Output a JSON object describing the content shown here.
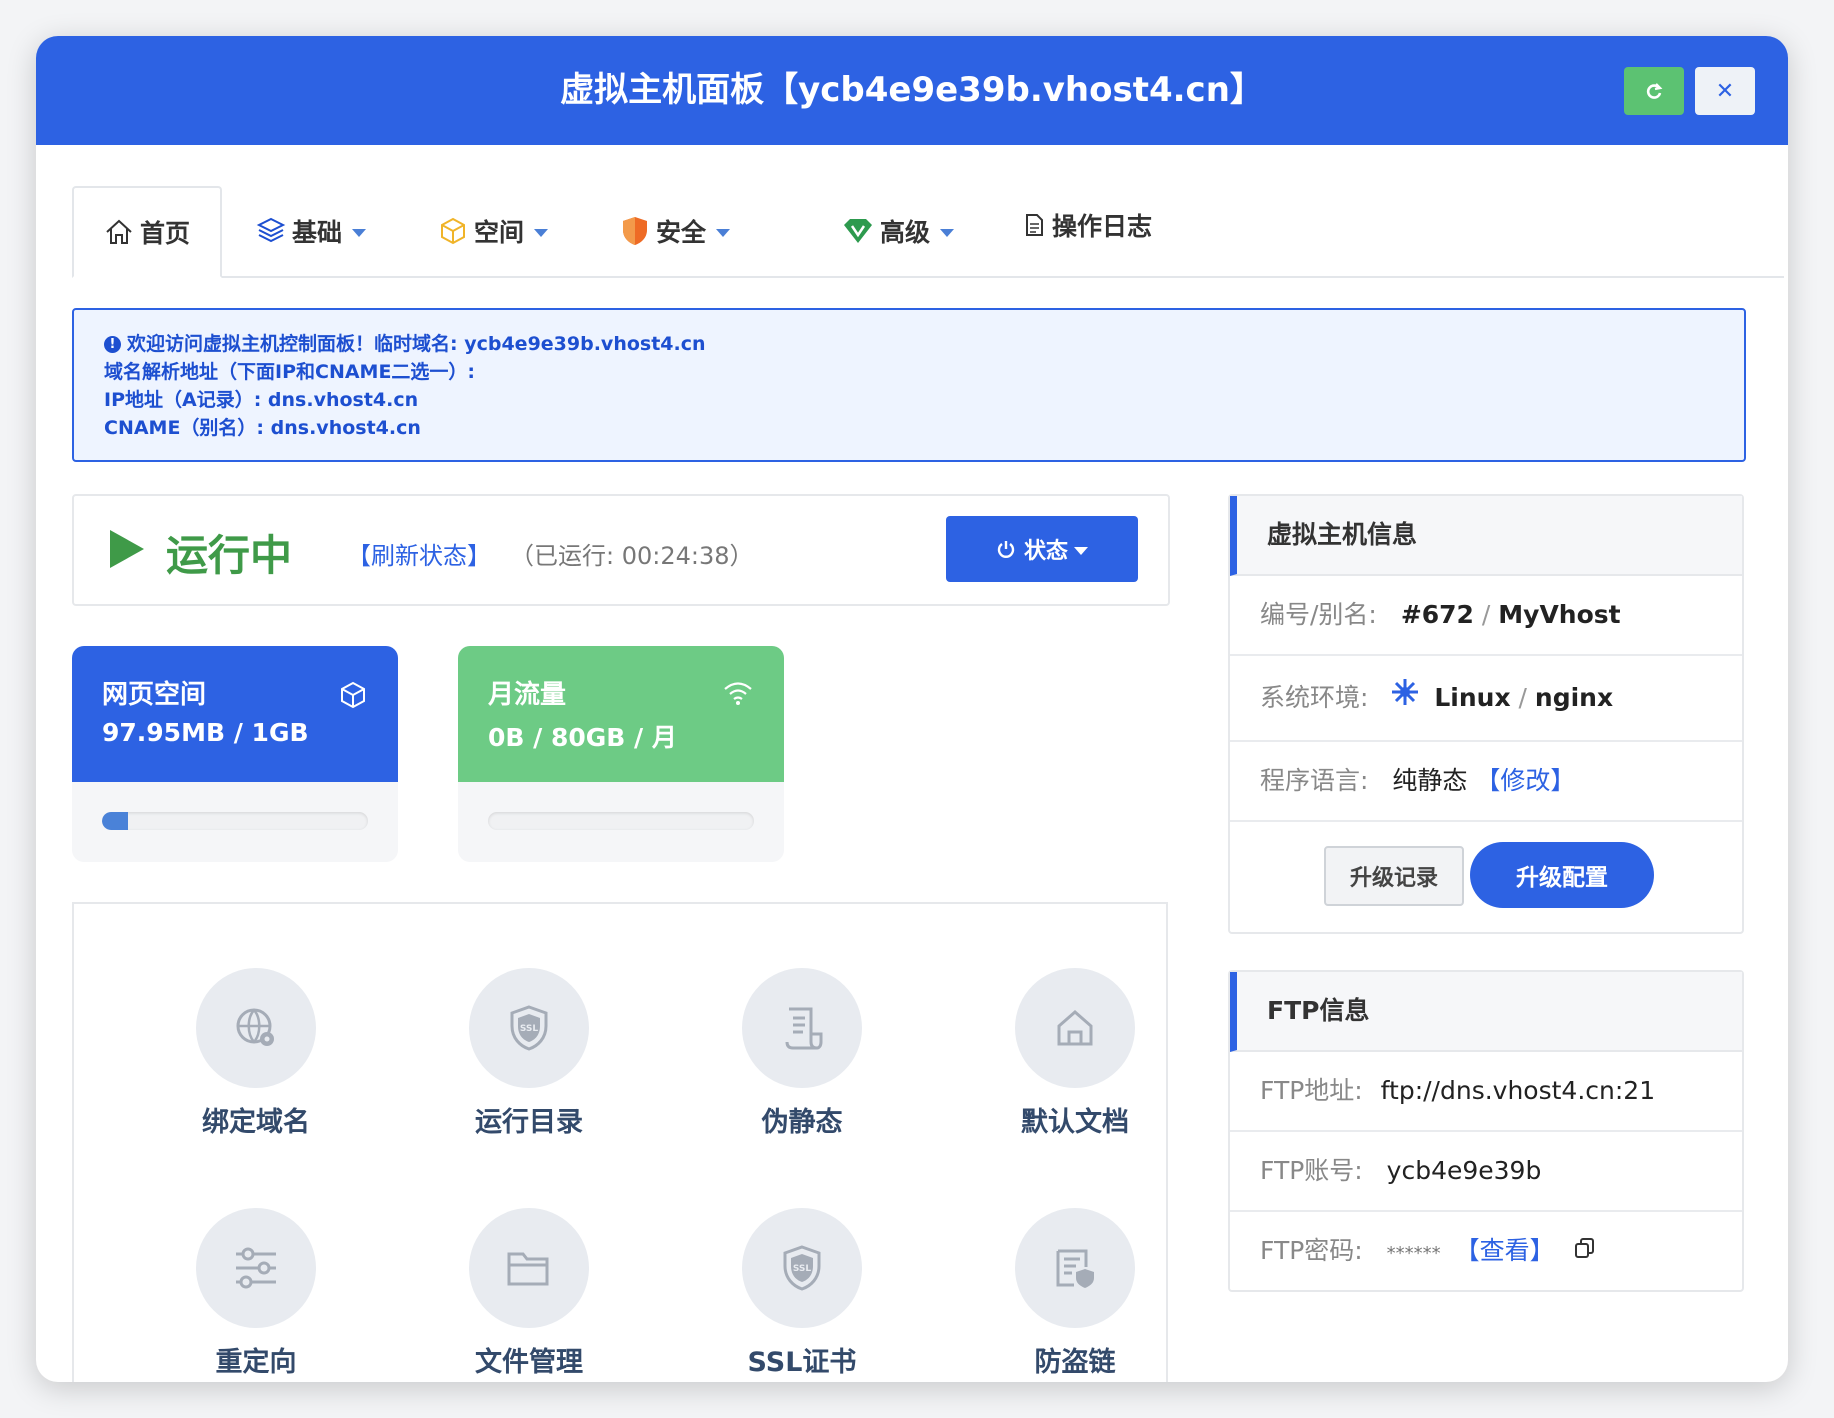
{
  "window": {
    "title": "虚拟主机面板【ycb4e9e39b.vhost4.cn】"
  },
  "tabs": [
    {
      "label": "首页"
    },
    {
      "label": "基础"
    },
    {
      "label": "空间"
    },
    {
      "label": "安全"
    },
    {
      "label": "高级"
    },
    {
      "label": "操作日志"
    }
  ],
  "notice": {
    "line1": "欢迎访问虚拟主机控制面板！临时域名: ycb4e9e39b.vhost4.cn",
    "line2": "域名解析地址（下面IP和CNAME二选一）:",
    "line3": "IP地址（A记录）: dns.vhost4.cn",
    "line4": "CNAME（别名）: dns.vhost4.cn"
  },
  "status": {
    "state": "运行中",
    "refresh_label": "【刷新状态】",
    "uptime_label": "（已运行:",
    "uptime_value": "00:24:38）",
    "button_label": "状态"
  },
  "cards": {
    "space": {
      "title": "网页空间",
      "value": "97.95MB / 1GB",
      "usage": 0.096,
      "color": "#2d62e3"
    },
    "traffic": {
      "title": "月流量",
      "value": "0B / 80GB / 月",
      "usage": 0,
      "color": "#6dcb85"
    }
  },
  "grid": [
    {
      "label": "绑定域名",
      "icon": "globe-gear-icon"
    },
    {
      "label": "运行目录",
      "icon": "ssl-shield-icon"
    },
    {
      "label": "伪静态",
      "icon": "scroll-icon"
    },
    {
      "label": "默认文档",
      "icon": "home-icon"
    },
    {
      "label": "重定向",
      "icon": "sliders-icon"
    },
    {
      "label": "文件管理",
      "icon": "folder-icon"
    },
    {
      "label": "SSL证书",
      "icon": "ssl-shield-icon"
    },
    {
      "label": "防盗链",
      "icon": "document-shield-icon"
    }
  ],
  "vhost_info": {
    "title": "虚拟主机信息",
    "id_label": "编号/别名:",
    "id_value": "#672",
    "alias_value": "MyVhost",
    "env_label": "系统环境:",
    "os_value": "Linux",
    "server_value": "nginx",
    "lang_label": "程序语言:",
    "lang_value": "纯静态",
    "modify_label": "【修改】",
    "log_button": "升级记录",
    "upgrade_button": "升级配置"
  },
  "ftp_info": {
    "title": "FTP信息",
    "address_label": "FTP地址:",
    "address_value": "ftp://dns.vhost4.cn:21",
    "account_label": "FTP账号:",
    "account_value": "ycb4e9e39b",
    "password_label": "FTP密码:",
    "password_value": "******",
    "view_label": "【查看】"
  }
}
